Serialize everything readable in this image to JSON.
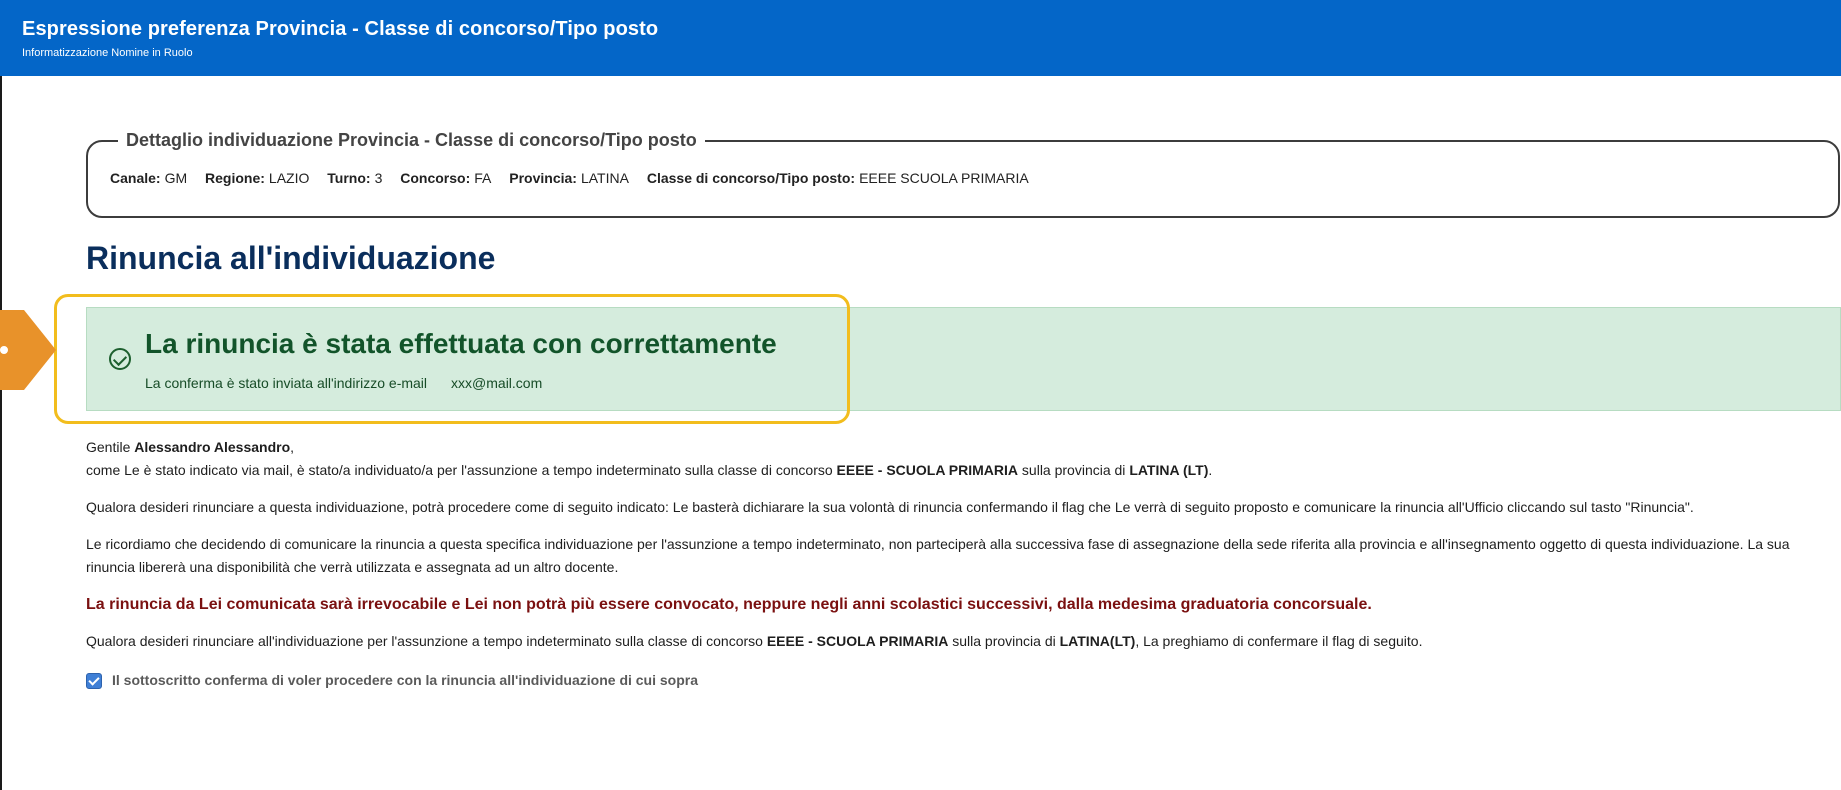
{
  "header": {
    "title": "Espressione preferenza Provincia - Classe di concorso/Tipo posto",
    "subtitle": "Informatizzazione Nomine in Ruolo"
  },
  "detail": {
    "legend": "Dettaglio individuazione Provincia - Classe di concorso/Tipo posto",
    "fields": [
      {
        "label": "Canale:",
        "value": "GM"
      },
      {
        "label": "Regione:",
        "value": "LAZIO"
      },
      {
        "label": "Turno:",
        "value": "3"
      },
      {
        "label": "Concorso:",
        "value": "FA"
      },
      {
        "label": "Provincia:",
        "value": "LATINA"
      },
      {
        "label": "Classe di concorso/Tipo posto:",
        "value": "EEEE SCUOLA PRIMARIA"
      }
    ]
  },
  "section": {
    "title": "Rinuncia all'individuazione"
  },
  "alert": {
    "heading": "La rinuncia è stata effettuata con correttamente",
    "message": "La conferma è stato inviata all'indirizzo e-mail",
    "email": "xxx@mail.com",
    "highlight_color": "#f2bd1d",
    "background_color": "#d5ecdd"
  },
  "body": {
    "greeting_prefix": "Gentile ",
    "greeting_name": "Alessandro Alessandro",
    "greeting_suffix": ",",
    "intro_1": "come Le è stato indicato via mail, è stato/a individuato/a per l'assunzione a tempo indeterminato sulla classe di concorso ",
    "intro_class": "EEEE - SCUOLA PRIMARIA",
    "intro_2": " sulla provincia di ",
    "intro_province": "LATINA (LT)",
    "intro_3": ".",
    "para_1": "Qualora desideri rinunciare a questa individuazione, potrà procedere come di seguito indicato: Le basterà dichiarare la sua volontà di rinuncia confermando il flag che Le verrà di seguito proposto e comunicare la rinuncia all'Ufficio cliccando sul tasto \"Rinuncia\".",
    "para_2": "Le ricordiamo che decidendo di comunicare la rinuncia a questa specifica individuazione per l'assunzione a tempo indeterminato, non parteciperà alla successiva fase di assegnazione della sede riferita alla provincia e all'insegnamento oggetto di questa individuazione. La sua rinuncia libererà una disponibilità che verrà utilizzata e assegnata ad un altro docente.",
    "warning": "La rinuncia da Lei comunicata sarà irrevocabile e Lei non potrà più essere convocato, neppure negli anni scolastici successivi, dalla medesima graduatoria concorsuale.",
    "para_3_1": "Qualora desideri rinunciare all'individuazione per l'assunzione a tempo indeterminato sulla classe di concorso ",
    "para_3_class": "EEEE - SCUOLA PRIMARIA",
    "para_3_2": " sulla provincia di ",
    "para_3_province": "LATINA(LT)",
    "para_3_3": ", La preghiamo di confermare il flag di seguito.",
    "checkbox_label": "Il sottoscritto conferma di voler procedere con la rinuncia all'individuazione di cui sopra",
    "checkbox_checked": true
  },
  "colors": {
    "header_bg": "#0466c8",
    "title": "#0a2e5c",
    "warning": "#7a1010",
    "pointer": "#e8922a"
  }
}
